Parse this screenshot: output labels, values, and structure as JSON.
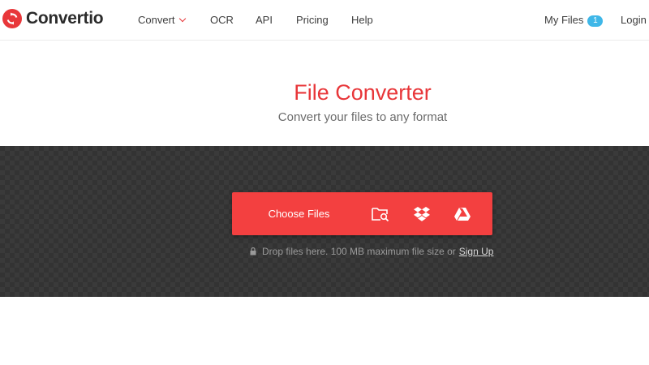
{
  "brand": {
    "name": "Convertio",
    "accent": "#e8373a"
  },
  "nav": {
    "convert": "Convert",
    "ocr": "OCR",
    "api": "API",
    "pricing": "Pricing",
    "help": "Help",
    "my_files": "My Files",
    "my_files_count": "1",
    "login": "Login"
  },
  "hero": {
    "title": "File Converter",
    "subtitle": "Convert your files to any format"
  },
  "upload": {
    "choose_files": "Choose Files",
    "sources": [
      "folder-search-icon",
      "dropbox-icon",
      "google-drive-icon"
    ],
    "hint": "Drop files here. 100 MB maximum file size or",
    "signup": "Sign Up"
  },
  "colors": {
    "button": "#f34040",
    "badge": "#3fb7e8",
    "dropzone": "#333333"
  }
}
